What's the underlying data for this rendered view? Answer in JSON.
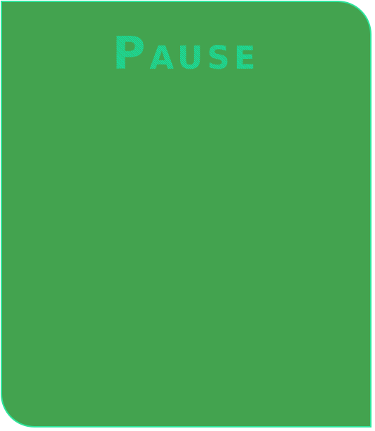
{
  "pause_menu": {
    "title": "Pause"
  },
  "colors": {
    "panel_background": "#43a34f",
    "panel_border": "#2ee59c",
    "title_text": "#12e6a6"
  }
}
